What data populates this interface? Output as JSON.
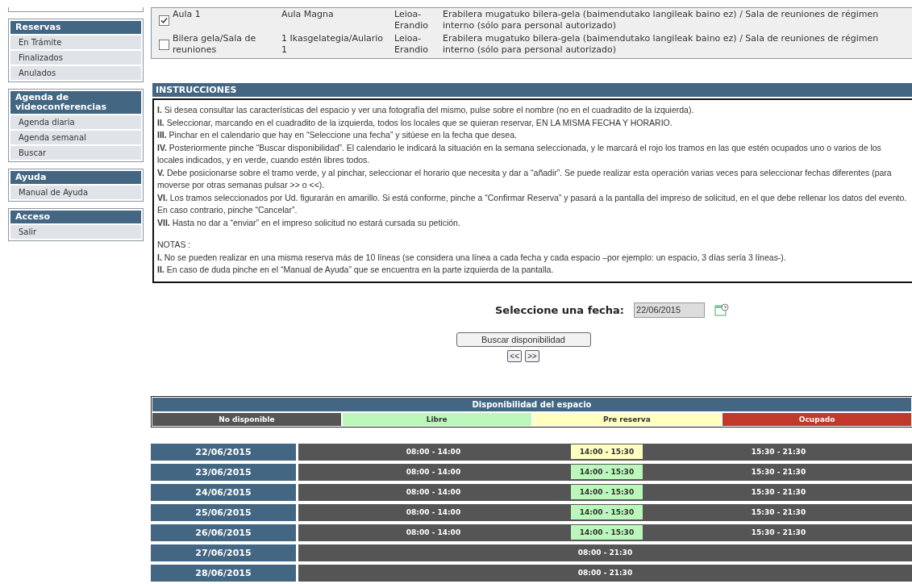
{
  "sidebar": {
    "groups": [
      {
        "title": "Reservas",
        "items": [
          "En Trámite",
          "Finalizados",
          "Anulados"
        ]
      },
      {
        "title": "Agenda de videoconferencias",
        "items": [
          "Agenda diaria",
          "Agenda semanal",
          "Buscar"
        ]
      },
      {
        "title": "Ayuda",
        "items": [
          "Manual de Ayuda"
        ]
      },
      {
        "title": "Acceso",
        "items": [
          "Salir"
        ]
      }
    ]
  },
  "spaces": [
    {
      "checked": true,
      "name": "Aula 1",
      "building": "Aula Magna",
      "campus": "Leioa-Erandio",
      "description": "Erabilera mugatuko bilera-gela (baimendutako langileak baino ez) / Sala de reuniones de régimen interno (sólo para personal autorizado)"
    },
    {
      "checked": false,
      "name": "Bilera gela/Sala de reuniones",
      "building": "1 Ikasgelategia/Aulario 1",
      "campus": "Leioa-Erandio",
      "description": "Erabilera mugatuko bilera-gela (baimendutako langileak baino ez) / Sala de reuniones de régimen interno (sólo para personal autorizado)"
    }
  ],
  "instructions": {
    "title": "INSTRUCCIONES",
    "steps": [
      "**I.** Si desea consultar las características del espacio y ver una fotografía del mismo, pulse sobre el nombre (no en el cuadradito de la izquierda).",
      "**II.** Seleccionar, marcando en el cuadradito de la izquierda, todos los locales que se quieran reservar, EN LA MISMA FECHA Y HORARIO.",
      "**III.** Pinchar en el calendario que hay en “Seleccione una fecha” y sitúese en la fecha que desea.",
      "**IV.** Posteriormente pinche “Buscar disponibilidad”. El calendario le indicará la situación en la semana seleccionada, y le marcará el rojo los tramos en las que estén ocupados uno o varios de los locales indicados, y en verde, cuando estén libres todos.",
      "**V.** Debe posicionarse sobre el tramo verde, y al pinchar, seleccionar el horario que necesita y dar a “añadir”. Se puede realizar esta operación varias veces para seleccionar fechas diferentes (para moverse por otras semanas pulsar >> o <<).",
      "**VI.** Los tramos seleccionados por Ud. figurarán en amarillo. Si está conforme, pinche a “Confirmar Reserva” y pasará a la pantalla del impreso de solicitud, en el que debe rellenar los datos del evento. En caso contrario, pinche “Cancelar”.",
      "**VII.** Hasta no dar a “enviar” en el impreso solicitud no estará cursada su petición."
    ],
    "notes_title": "NOTAS :",
    "notes": [
      "**I.** No se pueden realizar en una misma reserva más de 10 líneas (se considera una línea a cada fecha y cada espacio –por ejemplo: un espacio, 3 días sería 3 líneas-).",
      "**II.** En caso de duda pinche en el “Manual de Ayuda” que se encuentra en la parte izquierda de la pantalla."
    ]
  },
  "date_picker": {
    "label": "Seleccione una fecha:",
    "value": "22/06/2015"
  },
  "search_button": "Buscar disponibilidad",
  "nav_buttons": [
    "<<",
    ">>"
  ],
  "availability": {
    "title": "Disponibilidad del espacio",
    "legend": [
      {
        "label": "No disponible",
        "color": "#555555"
      },
      {
        "label": "Libre",
        "color": "#bbf7bb"
      },
      {
        "label": "Pre reserva",
        "color": "#ffffc0"
      },
      {
        "label": "Ocupado",
        "color": "#c0392b"
      }
    ],
    "days": [
      {
        "date": "22/06/2015",
        "slots": [
          {
            "time": "08:00 - 14:00",
            "color": "#555555"
          },
          {
            "time": "14:00 - 15:30",
            "color": "#ffffc0"
          },
          {
            "time": "15:30 - 21:30",
            "color": "#555555"
          }
        ]
      },
      {
        "date": "23/06/2015",
        "slots": [
          {
            "time": "08:00 - 14:00",
            "color": "#555555"
          },
          {
            "time": "14:00 - 15:30",
            "color": "#bbf7bb"
          },
          {
            "time": "15:30 - 21:30",
            "color": "#555555"
          }
        ]
      },
      {
        "date": "24/06/2015",
        "slots": [
          {
            "time": "08:00 - 14:00",
            "color": "#555555"
          },
          {
            "time": "14:00 - 15:30",
            "color": "#bbf7bb"
          },
          {
            "time": "15:30 - 21:30",
            "color": "#555555"
          }
        ]
      },
      {
        "date": "25/06/2015",
        "slots": [
          {
            "time": "08:00 - 14:00",
            "color": "#555555"
          },
          {
            "time": "14:00 - 15:30",
            "color": "#bbf7bb"
          },
          {
            "time": "15:30 - 21:30",
            "color": "#555555"
          }
        ]
      },
      {
        "date": "26/06/2015",
        "slots": [
          {
            "time": "08:00 - 14:00",
            "color": "#555555"
          },
          {
            "time": "14:00 - 15:30",
            "color": "#bbf7bb"
          },
          {
            "time": "15:30 - 21:30",
            "color": "#555555"
          }
        ]
      },
      {
        "date": "27/06/2015",
        "slots": [
          {
            "time": "08:00 - 21:30",
            "color": "#555555"
          }
        ]
      },
      {
        "date": "28/06/2015",
        "slots": [
          {
            "time": "08:00 - 21:30",
            "color": "#555555"
          }
        ]
      }
    ]
  }
}
